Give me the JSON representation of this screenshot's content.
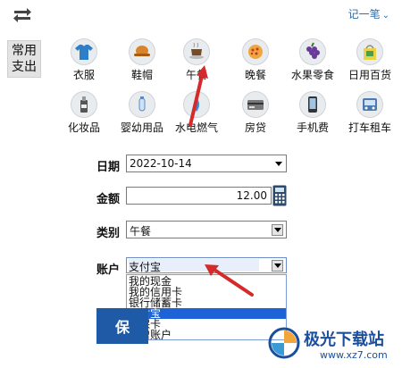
{
  "header": {
    "link_label": "记一笔",
    "link_chevron": "⌄"
  },
  "side_label": "常用支出",
  "categories": [
    {
      "label": "衣服",
      "icon": "shirt-icon"
    },
    {
      "label": "鞋帽",
      "icon": "hat-icon"
    },
    {
      "label": "午餐",
      "icon": "coffee-icon"
    },
    {
      "label": "晚餐",
      "icon": "pizza-icon"
    },
    {
      "label": "水果零食",
      "icon": "grapes-icon"
    },
    {
      "label": "日用百货",
      "icon": "shopping-bag-icon"
    },
    {
      "label": "化妆品",
      "icon": "cosmetics-icon"
    },
    {
      "label": "婴幼用品",
      "icon": "baby-icon"
    },
    {
      "label": "水电燃气",
      "icon": "utility-icon"
    },
    {
      "label": "房贷",
      "icon": "card-icon"
    },
    {
      "label": "手机费",
      "icon": "phone-icon"
    },
    {
      "label": "打车租车",
      "icon": "car-icon"
    }
  ],
  "form": {
    "date_label": "日期",
    "date_value": "2022-10-14",
    "amount_label": "金额",
    "amount_value": "12.00",
    "category_label": "类别",
    "category_value": "午餐",
    "account_label": "账户",
    "account_value": "支付宝",
    "account_options": [
      "我的现金",
      "我的信用卡",
      "银行储蓄卡",
      "支付宝",
      "医保卡",
      "新增账户"
    ],
    "selected_index": 3
  },
  "save_button": "保",
  "watermark": {
    "title": "极光下载站",
    "url": "www.xz7.com"
  },
  "colors": {
    "accent": "#1e63d6",
    "annotation_arrow": "#d42a2a",
    "link": "#2a6fb0"
  }
}
